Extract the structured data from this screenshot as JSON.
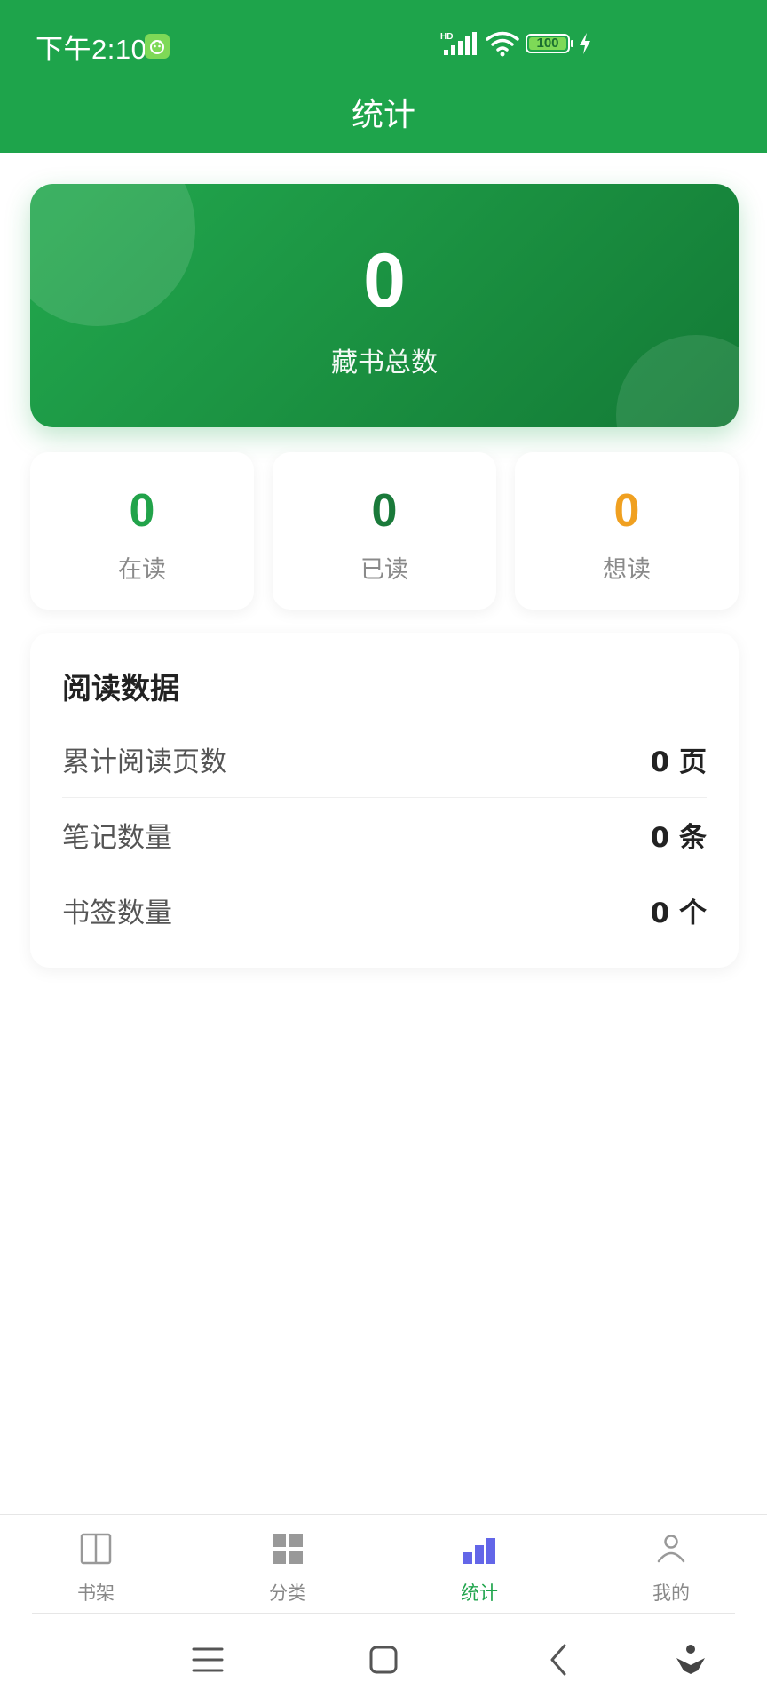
{
  "status_bar": {
    "time": "下午2:10",
    "battery": "100",
    "network_label": "HD"
  },
  "header": {
    "title": "统计"
  },
  "hero": {
    "value": "0",
    "label": "藏书总数"
  },
  "stats": [
    {
      "value": "0",
      "label": "在读",
      "color": "#22a34a"
    },
    {
      "value": "0",
      "label": "已读",
      "color": "#1a7a3a"
    },
    {
      "value": "0",
      "label": "想读",
      "color": "#f0a020"
    }
  ],
  "reading_data": {
    "title": "阅读数据",
    "rows": [
      {
        "label": "累计阅读页数",
        "value": "0 页"
      },
      {
        "label": "笔记数量",
        "value": "0 条"
      },
      {
        "label": "书签数量",
        "value": "0 个"
      }
    ]
  },
  "tabs": [
    {
      "label": "书架",
      "icon": "book-icon",
      "active": false
    },
    {
      "label": "分类",
      "icon": "grid-icon",
      "active": false
    },
    {
      "label": "统计",
      "icon": "bar-chart-icon",
      "active": true
    },
    {
      "label": "我的",
      "icon": "person-icon",
      "active": false
    }
  ],
  "colors": {
    "brand": "#1ea44b",
    "active_tab_icon": "#6366e8",
    "inactive": "#888888"
  }
}
